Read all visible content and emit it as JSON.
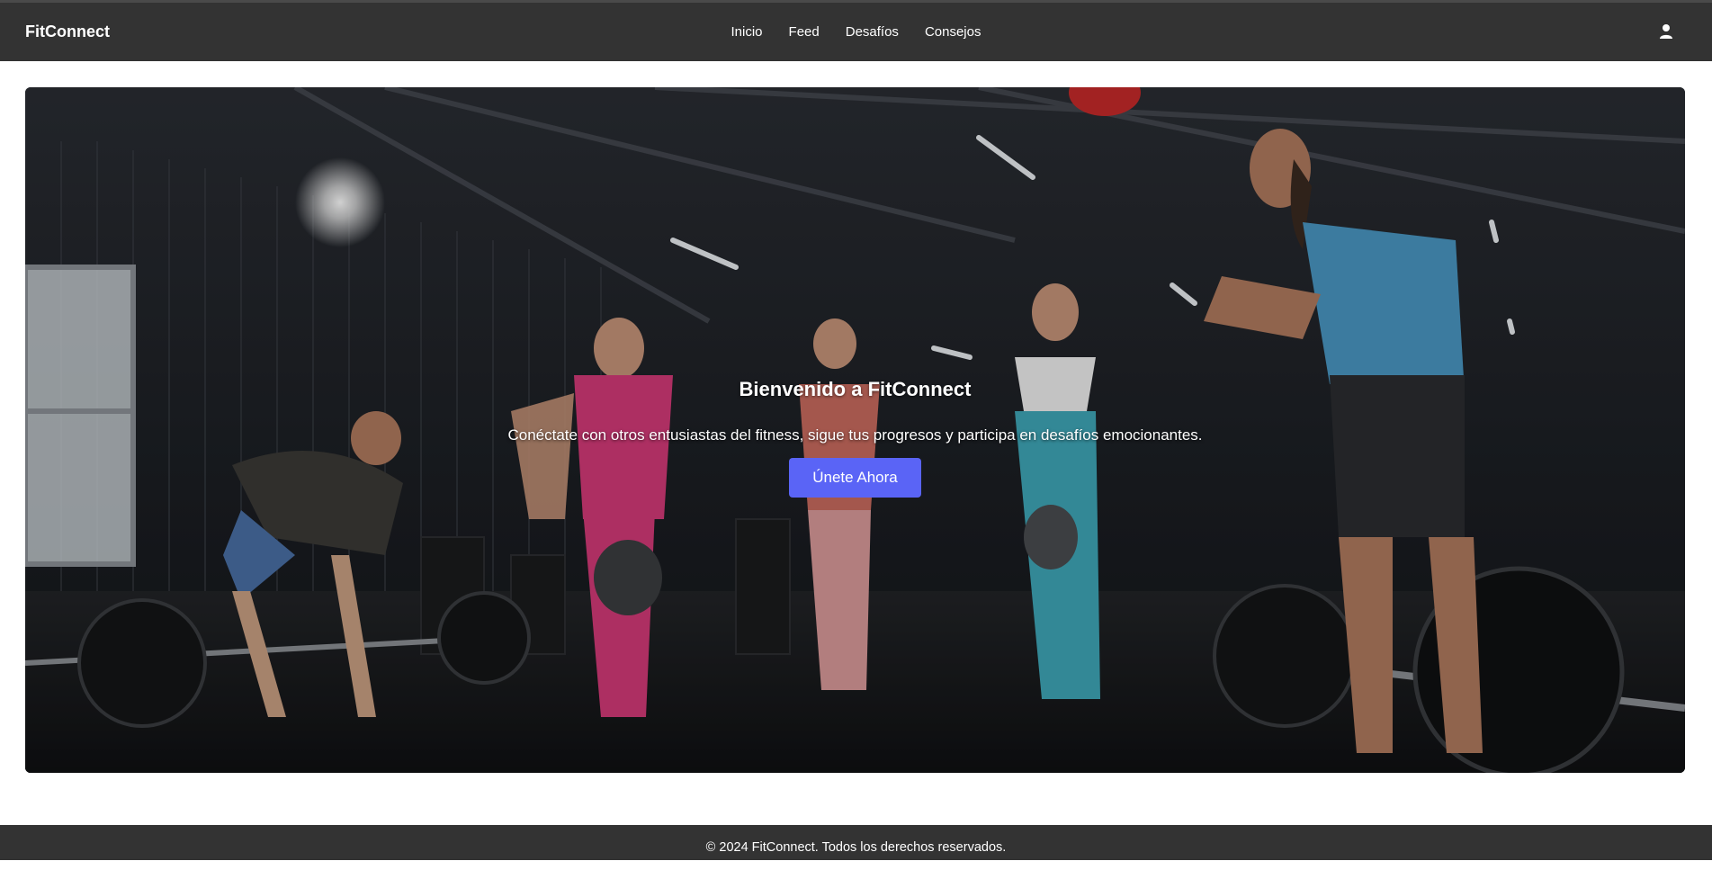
{
  "header": {
    "brand": "FitConnect",
    "nav": [
      "Inicio",
      "Feed",
      "Desafíos",
      "Consejos"
    ],
    "user_icon": "user-icon"
  },
  "hero": {
    "title": "Bienvenido a FitConnect",
    "subtitle": "Conéctate con otros entusiastas del fitness, sigue tus progresos y participa en desafíos emocionantes.",
    "cta_label": "Únete Ahora",
    "cta_color": "#5a64f6",
    "background": "gym-photo"
  },
  "footer": {
    "text": "© 2024 FitConnect. Todos los derechos reservados."
  },
  "colors": {
    "navbar": "#333333",
    "footer": "#333333"
  }
}
